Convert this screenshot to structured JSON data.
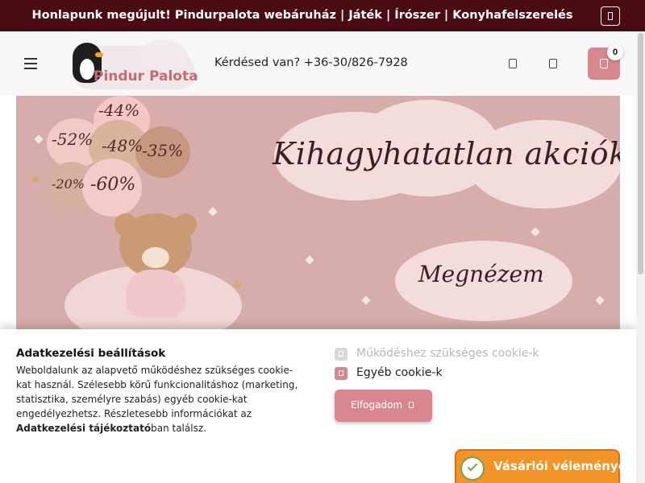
{
  "topbar": {
    "message": "Honlapunk megújult! Pindurpalota webáruház | Játék | Írószer | Konyhafelszerelés",
    "close_icon": "close-square-icon"
  },
  "header": {
    "menu_icon": "hamburger-menu-icon",
    "logo_text": "Pindur Palota",
    "phone_text": "Kérdésed van? +36-30/826-7928",
    "user_icon": "user-icon",
    "wishlist_icon": "heart-icon",
    "cart": {
      "icon": "cart-icon",
      "count": "0"
    }
  },
  "banner": {
    "headline": "Kihagyhatatlan akciók",
    "cta": "Megnézem",
    "balloon_labels": [
      "-44%",
      "-52%",
      "-48%",
      "-35%",
      "-20%",
      "-60%"
    ]
  },
  "cookie": {
    "title": "Adatkezelési beállítások",
    "desc_before": "Weboldalunk az alapvető működéshez szükséges cookie-kat használ. Szélesebb körű funkcionalitáshoz (marketing, statisztika, személyre szabás) egyéb cookie-kat engedélyezhetsz. Részletesebb információkat az ",
    "desc_link": "Adatkezelési tájékoztató",
    "desc_after": "ban találsz.",
    "option_required": "Működéshez szükséges cookie-k",
    "option_other": "Egyéb cookie-k",
    "accept_label": "Elfogadom"
  },
  "reviews": {
    "label": "Vásárlói vélemények",
    "badge_icon": "verified-badge-icon"
  },
  "colors": {
    "topbar": "#4a0c12",
    "accent": "#d9878f",
    "banner": "#d7adab",
    "reviews": "#f29425"
  }
}
